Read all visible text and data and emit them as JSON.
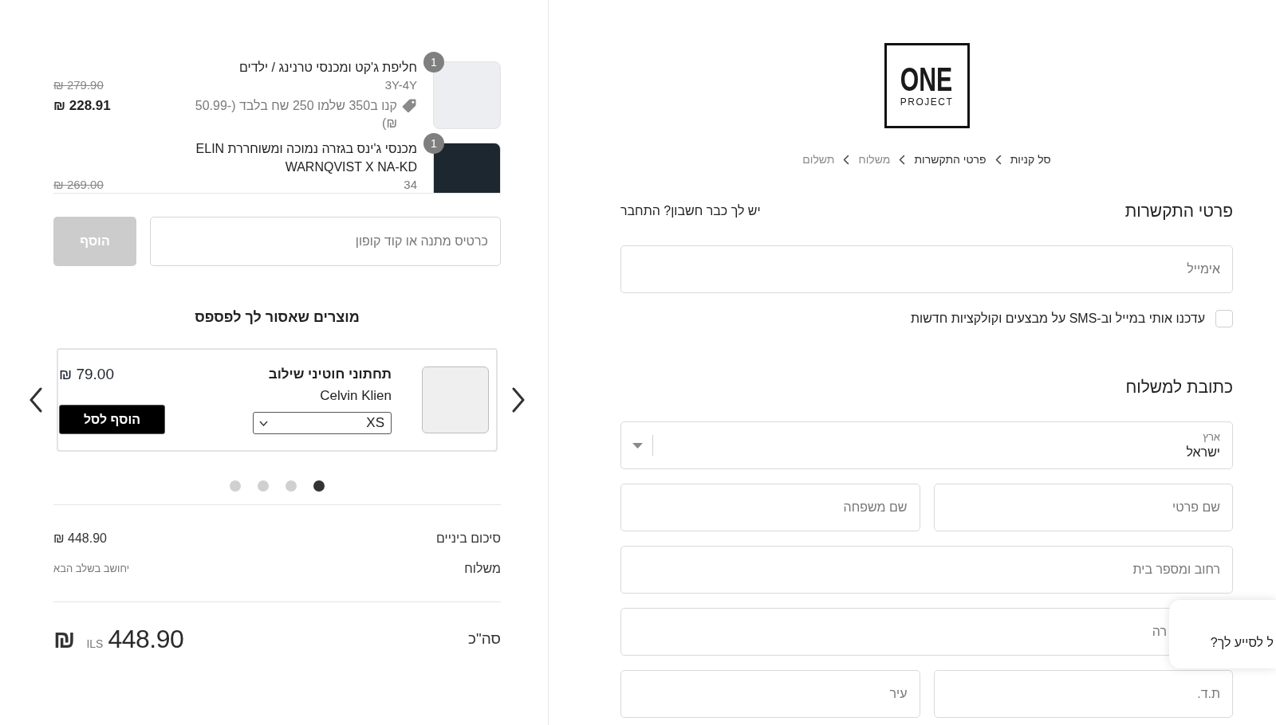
{
  "order_summary": {
    "cart_items": [
      {
        "quantity": "1",
        "title": "חליפת ג'קט ומכנסי טרנינג / ילדים",
        "variant": "3Y-4Y",
        "discount": "קנו ב350 שלמו 250 שח בלבד (-50.99 ₪)",
        "original_price": "₪ 279.90",
        "price": "₪ 228.91"
      },
      {
        "quantity": "1",
        "title": "מכנסי ג'ינס בגזרה נמוכה ומשוחררת ELIN WARNQVIST X NA-KD",
        "variant": "34",
        "original_price": "₪ 269.00"
      }
    ],
    "coupon": {
      "placeholder": "כרטיס מתנה או קוד קופון",
      "button": "הוסף",
      "disabled": true
    },
    "recommendations": {
      "title": "מוצרים שאסור לך לפספס",
      "products": [
        {
          "name": "תחתוני חוטיני שילוב",
          "brand": "Celvin Klien",
          "size": "XS",
          "price": "₪ 79.00",
          "button": "הוסף לסל"
        }
      ],
      "dots": [
        {
          "selected": true
        },
        {
          "selected": false
        },
        {
          "selected": false
        },
        {
          "selected": false
        }
      ]
    },
    "totals": [
      {
        "kind": "amount",
        "label": "סיכום ביניים",
        "value": "₪ 448.90"
      },
      {
        "kind": "note",
        "label": "משלוח",
        "value": "יחושב בשלב הבא"
      }
    ],
    "total": {
      "label": "סה\"כ",
      "currency_symbol": "₪",
      "currency_code": "ILS",
      "amount": "448.90"
    }
  },
  "checkout": {
    "logo": {
      "wordmark": "ONE",
      "tagline": "PROJECT"
    },
    "breadcrumbs": [
      {
        "label": "סל קניות",
        "disabled": false
      },
      {
        "label": "פרטי התקשרות",
        "disabled": false
      },
      {
        "label": "משלוח",
        "disabled": true
      },
      {
        "label": "תשלום",
        "disabled": true
      }
    ],
    "contact": {
      "title": "פרטי התקשרות",
      "login_prompt": "יש לך כבר חשבון?",
      "login_link": "התחבר",
      "email": {
        "placeholder": "אימייל"
      },
      "newsletter": {
        "label": "עדכנו אותי במייל וב-SMS על מבצעים וקולקציות חדשות",
        "checked": false
      }
    },
    "shipping": {
      "title": "כתובת למשלוח",
      "rows": [
        {
          "fields": [
            {
              "kind": "select",
              "label": "ארץ",
              "value": "ישראל"
            }
          ]
        },
        {
          "fields": [
            {
              "kind": "text",
              "placeholder": "שם פרטי"
            },
            {
              "kind": "text",
              "placeholder": "שם משפחה"
            }
          ]
        },
        {
          "fields": [
            {
              "kind": "text",
              "placeholder": "רחוב ומספר בית"
            }
          ]
        },
        {
          "fields": [
            {
              "kind": "text",
              "placeholder": "רה"
            }
          ]
        },
        {
          "fields": [
            {
              "kind": "text",
              "placeholder": "ת.ד."
            },
            {
              "kind": "text",
              "placeholder": "עיר"
            }
          ]
        }
      ]
    }
  },
  "chat_popup": {
    "message": "ל לסייע לך?"
  }
}
